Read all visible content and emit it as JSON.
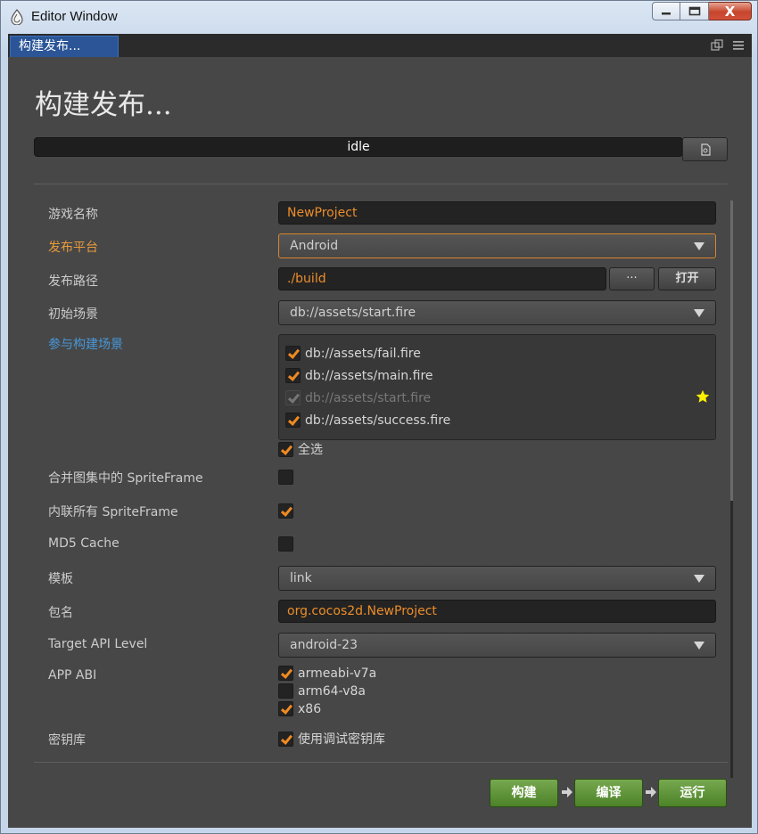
{
  "window": {
    "title": "Editor Window",
    "minimize_icon": "minimize-icon",
    "maximize_icon": "maximize-icon",
    "close_label": "X"
  },
  "tab": {
    "label": "构建发布..."
  },
  "page": {
    "title": "构建发布...",
    "status": "idle"
  },
  "form": {
    "game_name": {
      "label": "游戏名称",
      "value": "NewProject"
    },
    "platform": {
      "label": "发布平台",
      "value": "Android"
    },
    "build_path": {
      "label": "发布路径",
      "value": "./build",
      "browse_label": "···",
      "open_label": "打开"
    },
    "start_scene": {
      "label": "初始场景",
      "value": "db://assets/start.fire"
    },
    "scenes": {
      "label": "参与构建场景",
      "items": [
        {
          "path": "db://assets/fail.fire",
          "checked": true,
          "disabled": false
        },
        {
          "path": "db://assets/main.fire",
          "checked": true,
          "disabled": false
        },
        {
          "path": "db://assets/start.fire",
          "checked": true,
          "disabled": true
        },
        {
          "path": "db://assets/success.fire",
          "checked": true,
          "disabled": false
        }
      ],
      "select_all_label": "全选"
    },
    "merge_spriteframe": {
      "label": "合并图集中的 SpriteFrame",
      "checked": false
    },
    "inline_spriteframe": {
      "label": "内联所有 SpriteFrame",
      "checked": true
    },
    "md5_cache": {
      "label": "MD5 Cache",
      "checked": false
    },
    "template": {
      "label": "模板",
      "value": "link"
    },
    "package_name": {
      "label": "包名",
      "value": "org.cocos2d.NewProject"
    },
    "target_api": {
      "label": "Target API Level",
      "value": "android-23"
    },
    "app_abi": {
      "label": "APP ABI",
      "options": [
        {
          "name": "armeabi-v7a",
          "checked": true
        },
        {
          "name": "arm64-v8a",
          "checked": false
        },
        {
          "name": "x86",
          "checked": true
        }
      ]
    },
    "keystore": {
      "label": "密钥库",
      "option": "使用调试密钥库",
      "checked": true
    }
  },
  "actions": {
    "build": "构建",
    "compile": "编译",
    "run": "运行"
  },
  "colors": {
    "accent_orange": "#ec8d2a",
    "button_green": "#5d9436",
    "tab_blue": "#2b5596"
  }
}
